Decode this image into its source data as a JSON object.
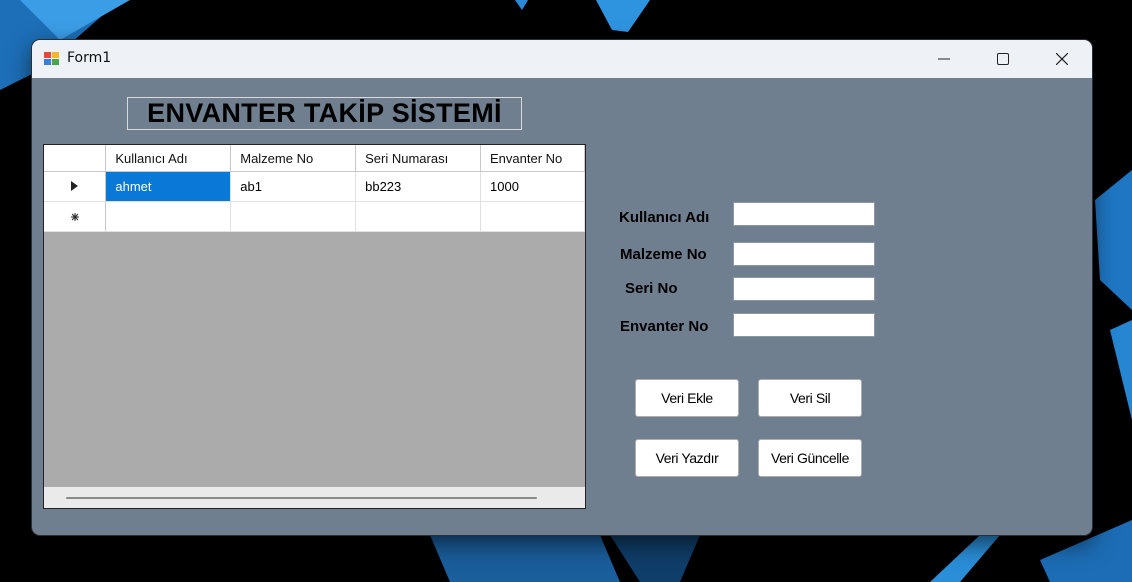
{
  "window": {
    "title": "Form1"
  },
  "heading": "ENVANTER TAKİP SİSTEMİ",
  "grid": {
    "columns": [
      "Kullanıcı Adı",
      "Malzeme No",
      "Seri Numarası",
      "Envanter No"
    ],
    "rows": [
      {
        "cells": [
          "ahmet",
          "ab1",
          "bb223",
          "1000"
        ]
      }
    ]
  },
  "form": {
    "kullanici_label": "Kullanıcı Adı",
    "malzeme_label": "Malzeme No",
    "seri_label": "Seri No",
    "envanter_label": "Envanter No",
    "kullanici_value": "",
    "malzeme_value": "",
    "seri_value": "",
    "envanter_value": ""
  },
  "buttons": {
    "ekle": "Veri Ekle",
    "sil": "Veri Sil",
    "yazdir": "Veri Yazdır",
    "guncelle": "Veri Güncelle"
  },
  "colors": {
    "form_background": "#6f7f8f",
    "selection": "#0a78d7",
    "grid_empty": "#ababab"
  }
}
